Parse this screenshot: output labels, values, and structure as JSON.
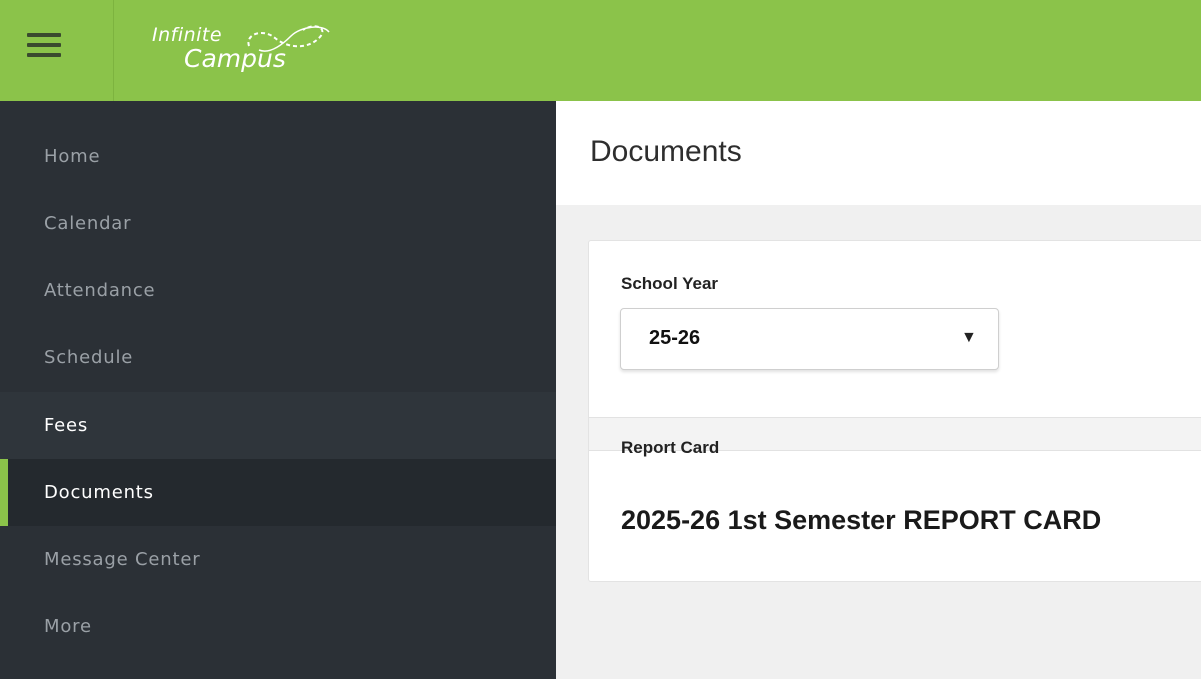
{
  "header": {
    "logo_line1": "Infinite",
    "logo_line2": "Campus",
    "brand_color": "#8bc34a"
  },
  "sidebar": {
    "items": [
      {
        "label": "Home"
      },
      {
        "label": "Calendar"
      },
      {
        "label": "Attendance"
      },
      {
        "label": "Schedule"
      },
      {
        "label": "Fees"
      },
      {
        "label": "Documents",
        "active": true
      },
      {
        "label": "Message Center"
      },
      {
        "label": "More"
      }
    ]
  },
  "main": {
    "title": "Documents",
    "school_year_label": "School Year",
    "school_year_value": "25-26",
    "section_label": "Report Card",
    "documents": [
      {
        "label": "2025-26 1st Semester REPORT CARD"
      }
    ]
  },
  "icons": {
    "menu": "hamburger-menu-icon",
    "dropdown": "caret-down-icon"
  }
}
